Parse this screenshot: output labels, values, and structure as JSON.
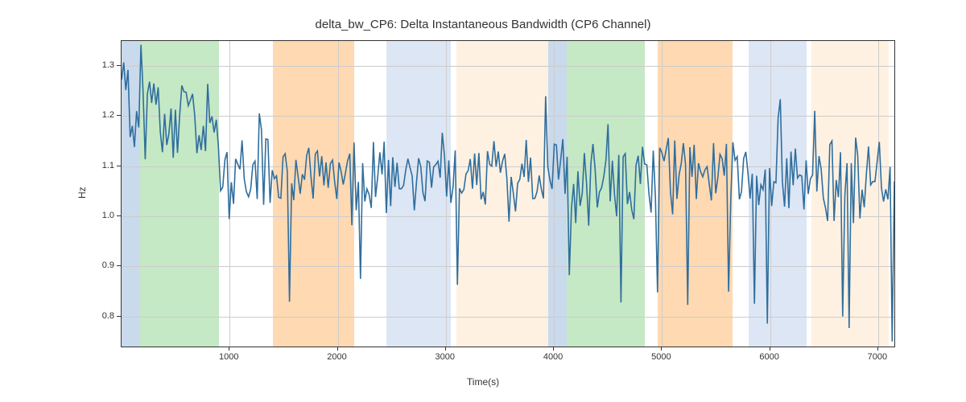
{
  "chart_data": {
    "type": "line",
    "title": "delta_bw_CP6: Delta Instantaneous Bandwidth (CP6 Channel)",
    "xlabel": "Time(s)",
    "ylabel": "Hz",
    "xlim": [
      0,
      7150
    ],
    "ylim": [
      0.74,
      1.35
    ],
    "x_ticks": [
      1000,
      2000,
      3000,
      4000,
      5000,
      6000,
      7000
    ],
    "y_ticks": [
      0.8,
      0.9,
      1.0,
      1.1,
      1.2,
      1.3
    ],
    "background_bands": [
      {
        "x0": 0,
        "x1": 170,
        "color": "blue"
      },
      {
        "x0": 170,
        "x1": 900,
        "color": "green"
      },
      {
        "x0": 1400,
        "x1": 2150,
        "color": "orange"
      },
      {
        "x0": 2450,
        "x1": 3050,
        "color": "lightblue"
      },
      {
        "x0": 3050,
        "x1": 3100,
        "color": "white_gap"
      },
      {
        "x0": 3100,
        "x1": 3950,
        "color": "cream"
      },
      {
        "x0": 3950,
        "x1": 4120,
        "color": "blue"
      },
      {
        "x0": 4120,
        "x1": 4840,
        "color": "green"
      },
      {
        "x0": 4960,
        "x1": 5650,
        "color": "orange"
      },
      {
        "x0": 5800,
        "x1": 6340,
        "color": "lightblue"
      },
      {
        "x0": 6380,
        "x1": 7100,
        "color": "cream"
      }
    ],
    "series": [
      {
        "name": "delta_bw_CP6",
        "x_step": 20,
        "values_approx": "noisy signal oscillating mostly between 0.9 and 1.3 Hz; first ~900s higher mean ~1.2; after ~900s mean drops to ~1.08 with spikes down to 0.75-0.88 and up to 1.28"
      }
    ]
  }
}
